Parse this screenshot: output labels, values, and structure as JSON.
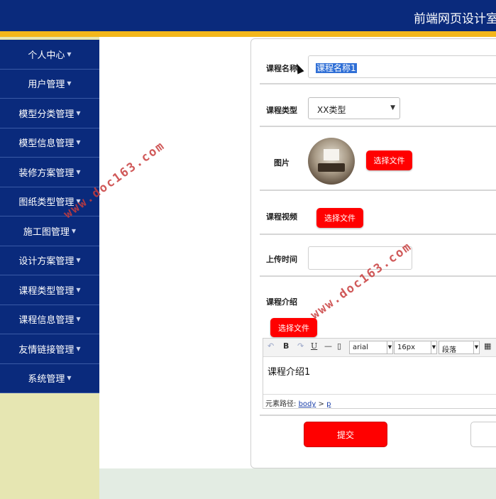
{
  "header": {
    "title": "前端网页设计室内"
  },
  "sidebar": {
    "items": [
      {
        "label": "个人中心"
      },
      {
        "label": "用户管理"
      },
      {
        "label": "模型分类管理"
      },
      {
        "label": "模型信息管理"
      },
      {
        "label": "装修方案管理"
      },
      {
        "label": "图纸类型管理"
      },
      {
        "label": "施工图管理"
      },
      {
        "label": "设计方案管理"
      },
      {
        "label": "课程类型管理"
      },
      {
        "label": "课程信息管理"
      },
      {
        "label": "友情链接管理"
      },
      {
        "label": "系统管理"
      }
    ]
  },
  "form": {
    "course_name_label": "课程名称",
    "course_name_value": "课程名称1",
    "course_type_label": "课程类型",
    "course_type_value": "XX类型",
    "image_label": "图片",
    "image_button": "选择文件",
    "video_label": "课程视频",
    "video_button": "选择文件",
    "upload_time_label": "上传时间",
    "upload_time_value": "",
    "intro_label": "课程介绍",
    "intro_button": "选择文件",
    "submit_label": "提交"
  },
  "editor": {
    "font_family": "arial",
    "font_size": "16px",
    "paragraph": "段落",
    "content": "课程介绍1",
    "path_label": "元素路径:",
    "path_body": "body",
    "path_sep": ">",
    "path_p": "p",
    "bold": "B",
    "underline": "U",
    "hr": "—"
  },
  "watermarks": [
    "www.doc163.com",
    "www.doc163.com"
  ],
  "colors": {
    "header_bg": "#0a2a7c",
    "stripe": "#f3b71b",
    "sidebar_bg": "#e6e6b2",
    "accent_button": "#ff0000"
  }
}
